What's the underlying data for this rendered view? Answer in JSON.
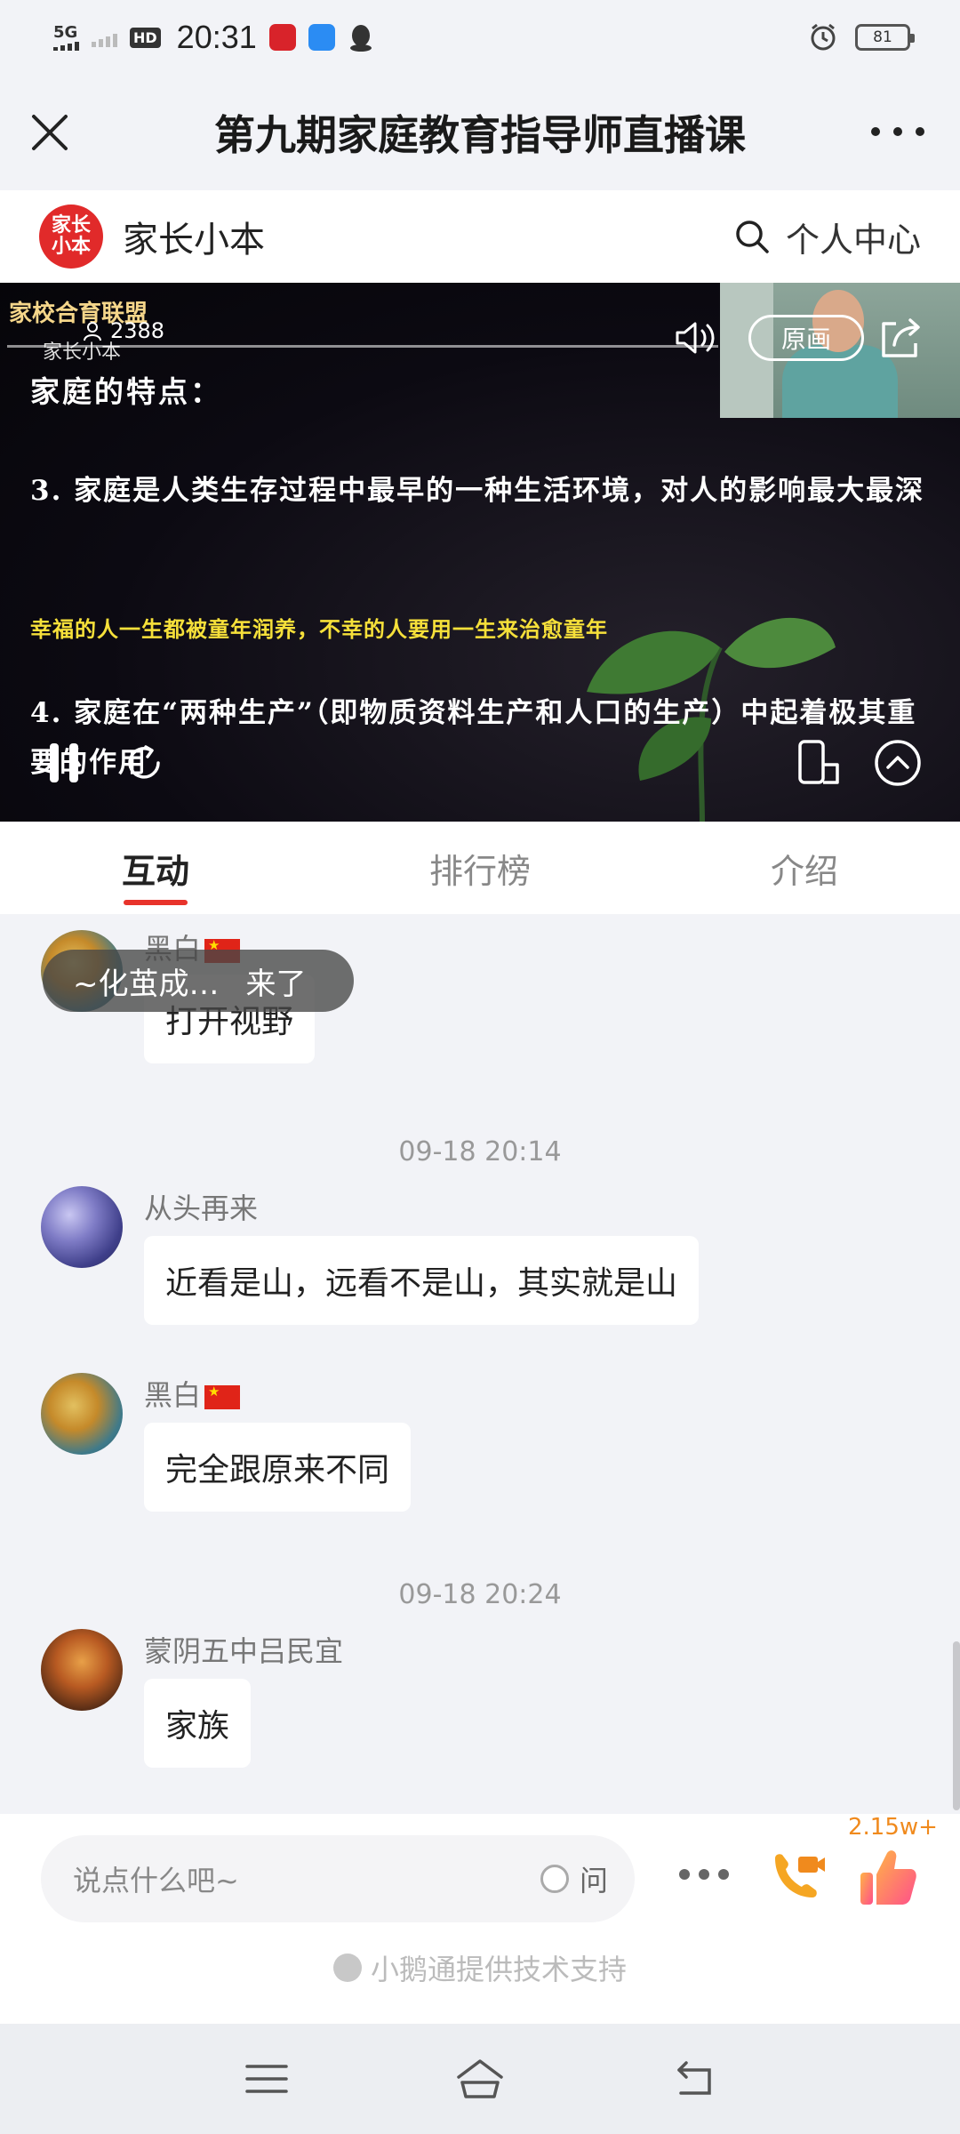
{
  "status_bar": {
    "network": "5G",
    "hd": "HD",
    "time": "20:31",
    "battery": "81"
  },
  "header": {
    "title": "第九期家庭教育指导师直播课"
  },
  "brand": {
    "logo_line1": "家长",
    "logo_line2": "小本",
    "name": "家长小本",
    "user_center": "个人中心"
  },
  "video": {
    "watermark": "家校合育联盟",
    "watermark_sub": "家长小本",
    "viewer_count": "2388",
    "quality": "原画",
    "slide": {
      "title": "家庭的特点：",
      "point3": "3. 家庭是人类生存过程中最早的一种生活环境，对人的影响最大最深",
      "quote": "幸福的人一生都被童年润养，不幸的人要用一生来治愈童年",
      "point4": "4. 家庭在“两种生产”（即物质资料生产和人口的生产）中起着极其重要的作用"
    }
  },
  "tabs": [
    {
      "label": "互动",
      "active": true
    },
    {
      "label": "排行榜",
      "active": false
    },
    {
      "label": "介绍",
      "active": false
    }
  ],
  "chat": {
    "join_toast": {
      "name": "~化茧成…",
      "action": "来了"
    },
    "messages": [
      {
        "nick": "黑白",
        "text": "打开视野"
      },
      {
        "time": "09-18 20:14"
      },
      {
        "nick": "从头再来",
        "text": "近看是山，远看不是山，其实就是山"
      },
      {
        "nick": "黑白",
        "text": "完全跟原来不同"
      },
      {
        "time": "09-18 20:24"
      },
      {
        "nick": "蒙阴五中吕民宜",
        "text": "家族"
      }
    ]
  },
  "input": {
    "placeholder": "说点什么吧~",
    "ask_label": "问",
    "like_count": "2.15w+",
    "powered_by": "小鹅通提供技术支持"
  },
  "colors": {
    "accent": "#e8332b",
    "like_orange": "#f08a1d",
    "slide_yellow": "#f6e03a"
  }
}
